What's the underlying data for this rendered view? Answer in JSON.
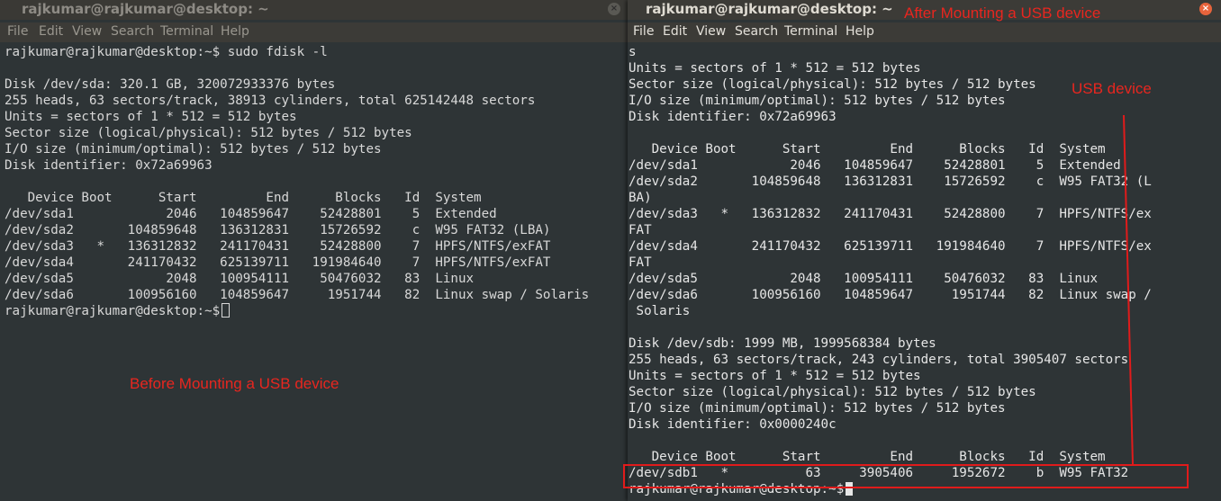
{
  "left_window": {
    "title": "rajkumar@rajkumar@desktop: ~",
    "close_glyph": "×",
    "menu": [
      "File",
      "Edit",
      "View",
      "Search",
      "Terminal",
      "Help"
    ],
    "lines": [
      "rajkumar@rajkumar@desktop:~$ sudo fdisk -l",
      "",
      "Disk /dev/sda: 320.1 GB, 320072933376 bytes",
      "255 heads, 63 sectors/track, 38913 cylinders, total 625142448 sectors",
      "Units = sectors of 1 * 512 = 512 bytes",
      "Sector size (logical/physical): 512 bytes / 512 bytes",
      "I/O size (minimum/optimal): 512 bytes / 512 bytes",
      "Disk identifier: 0x72a69963",
      "",
      "   Device Boot      Start         End      Blocks   Id  System",
      "/dev/sda1            2046   104859647    52428801    5  Extended",
      "/dev/sda2       104859648   136312831    15726592    c  W95 FAT32 (LBA)",
      "/dev/sda3   *   136312832   241170431    52428800    7  HPFS/NTFS/exFAT",
      "/dev/sda4       241170432   625139711   191984640    7  HPFS/NTFS/exFAT",
      "/dev/sda5            2048   100954111    50476032   83  Linux",
      "/dev/sda6       100956160   104859647     1951744   82  Linux swap / Solaris"
    ],
    "prompt": "rajkumar@rajkumar@desktop:~$ "
  },
  "right_window": {
    "title": "rajkumar@rajkumar@desktop: ~",
    "close_glyph": "×",
    "menu": [
      "File",
      "Edit",
      "View",
      "Search",
      "Terminal",
      "Help"
    ],
    "lines": [
      "s",
      "Units = sectors of 1 * 512 = 512 bytes",
      "Sector size (logical/physical): 512 bytes / 512 bytes",
      "I/O size (minimum/optimal): 512 bytes / 512 bytes",
      "Disk identifier: 0x72a69963",
      "",
      "   Device Boot      Start         End      Blocks   Id  System",
      "/dev/sda1            2046   104859647    52428801    5  Extended",
      "/dev/sda2       104859648   136312831    15726592    c  W95 FAT32 (L",
      "BA)",
      "/dev/sda3   *   136312832   241170431    52428800    7  HPFS/NTFS/ex",
      "FAT",
      "/dev/sda4       241170432   625139711   191984640    7  HPFS/NTFS/ex",
      "FAT",
      "/dev/sda5            2048   100954111    50476032   83  Linux",
      "/dev/sda6       100956160   104859647     1951744   82  Linux swap /",
      " Solaris",
      "",
      "Disk /dev/sdb: 1999 MB, 1999568384 bytes",
      "255 heads, 63 sectors/track, 243 cylinders, total 3905407 sectors",
      "Units = sectors of 1 * 512 = 512 bytes",
      "Sector size (logical/physical): 512 bytes / 512 bytes",
      "I/O size (minimum/optimal): 512 bytes / 512 bytes",
      "Disk identifier: 0x0000240c",
      "",
      "   Device Boot      Start         End      Blocks   Id  System",
      "/dev/sdb1   *          63     3905406     1952672    b  W95 FAT32"
    ],
    "prompt": "rajkumar@rajkumar@desktop:~$ "
  },
  "annotations": {
    "after": "After Mounting a USB device",
    "usb": "USB device",
    "before": "Before Mounting a USB device",
    "color": "#e8261f"
  }
}
